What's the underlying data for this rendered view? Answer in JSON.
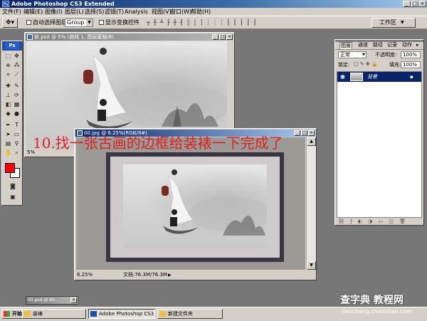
{
  "app": {
    "title": "Adobe Photoshop CS3 Extended"
  },
  "menu": [
    "文件(F)",
    "编辑(E)",
    "图像(I)",
    "图层(L)",
    "选择(S)",
    "滤镜(T)",
    "Analysis",
    "视图(V)",
    "窗口(W)",
    "帮助(H)"
  ],
  "options": {
    "auto_select_label": "自动选择图层",
    "auto_select_value": "Group",
    "show_transform_label": "显示变换控件",
    "workspace_label": "工作区"
  },
  "toolbox": {
    "logo": "Ps",
    "fg_color": "#ff0000",
    "bg_color": "#ffffff"
  },
  "doc1": {
    "title": "依.psd @ 5% (曲线 1, 图层蒙版/8)",
    "zoom": "5%"
  },
  "doc2": {
    "title": "00.jpg @ 6.25%(RGB/8#)",
    "zoom": "6.25%",
    "doc_size": "文档:76.3M/76.3M"
  },
  "doc3": {
    "title": "00.psd @ 66..."
  },
  "caption": "10.找一张古画的边框给装裱一下完成了",
  "layers_panel": {
    "tabs": [
      "图层",
      "通道",
      "路径",
      "记录",
      "动作"
    ],
    "blend_mode": "正常",
    "opacity_label": "不透明度:",
    "opacity_value": "100%",
    "lock_label": "锁定:",
    "fill_label": "填充:",
    "fill_value": "100%",
    "layer_name": "背景"
  },
  "taskbar": {
    "start": "开始",
    "items": [
      "装裱",
      "Adobe Photoshop CS3 E...",
      "新建文件夹"
    ]
  },
  "watermark": {
    "line1": "查字典 教程网",
    "line2": "jiaocheng.chazidian.com"
  }
}
